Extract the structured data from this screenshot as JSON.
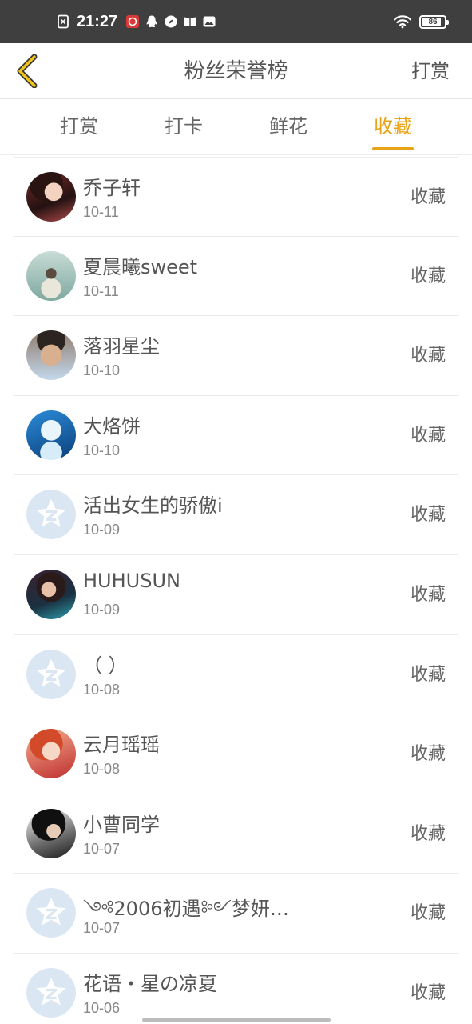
{
  "status_bar": {
    "time": "21:27",
    "battery_level": "86",
    "battery_fraction": 0.86,
    "icons": [
      "sim-off-icon",
      "app-notify-icon",
      "qq-icon",
      "compass-icon",
      "book-icon",
      "image-icon",
      "wifi-icon",
      "battery-icon"
    ]
  },
  "header": {
    "title": "粉丝荣誉榜",
    "action": "打赏",
    "back_icon": "chevron-left-icon"
  },
  "tabs": [
    {
      "label": "打赏",
      "active": false
    },
    {
      "label": "打卡",
      "active": false
    },
    {
      "label": "鲜花",
      "active": false
    },
    {
      "label": "收藏",
      "active": true
    }
  ],
  "colors": {
    "accent": "#e8a316",
    "status_bar": "#3f3f3f",
    "text": "#555555",
    "divider": "#e9e9e9",
    "default_avatar": "#dbe6f3"
  },
  "fans": [
    {
      "name": "乔子轩",
      "date": "10-11",
      "type": "收藏",
      "avatar": "photo"
    },
    {
      "name": "夏晨曦sweet",
      "date": "10-11",
      "type": "收藏",
      "avatar": "photo"
    },
    {
      "name": "落羽星尘",
      "date": "10-10",
      "type": "收藏",
      "avatar": "photo"
    },
    {
      "name": "大烙饼",
      "date": "10-10",
      "type": "收藏",
      "avatar": "photo"
    },
    {
      "name": "活出女生的骄傲i",
      "date": "10-09",
      "type": "收藏",
      "avatar": "default"
    },
    {
      "name": "HUHUSUN",
      "date": "10-09",
      "type": "收藏",
      "avatar": "photo"
    },
    {
      "name": "（ ）",
      "date": "10-08",
      "type": "收藏",
      "avatar": "default"
    },
    {
      "name": "云月瑶瑶",
      "date": "10-08",
      "type": "收藏",
      "avatar": "photo"
    },
    {
      "name": "小曹同学",
      "date": "10-07",
      "type": "收藏",
      "avatar": "photo"
    },
    {
      "name": "༺2006初遇༻梦妍…",
      "date": "10-07",
      "type": "收藏",
      "avatar": "default"
    },
    {
      "name": "花语・星の凉夏",
      "date": "10-06",
      "type": "收藏",
      "avatar": "default"
    }
  ]
}
